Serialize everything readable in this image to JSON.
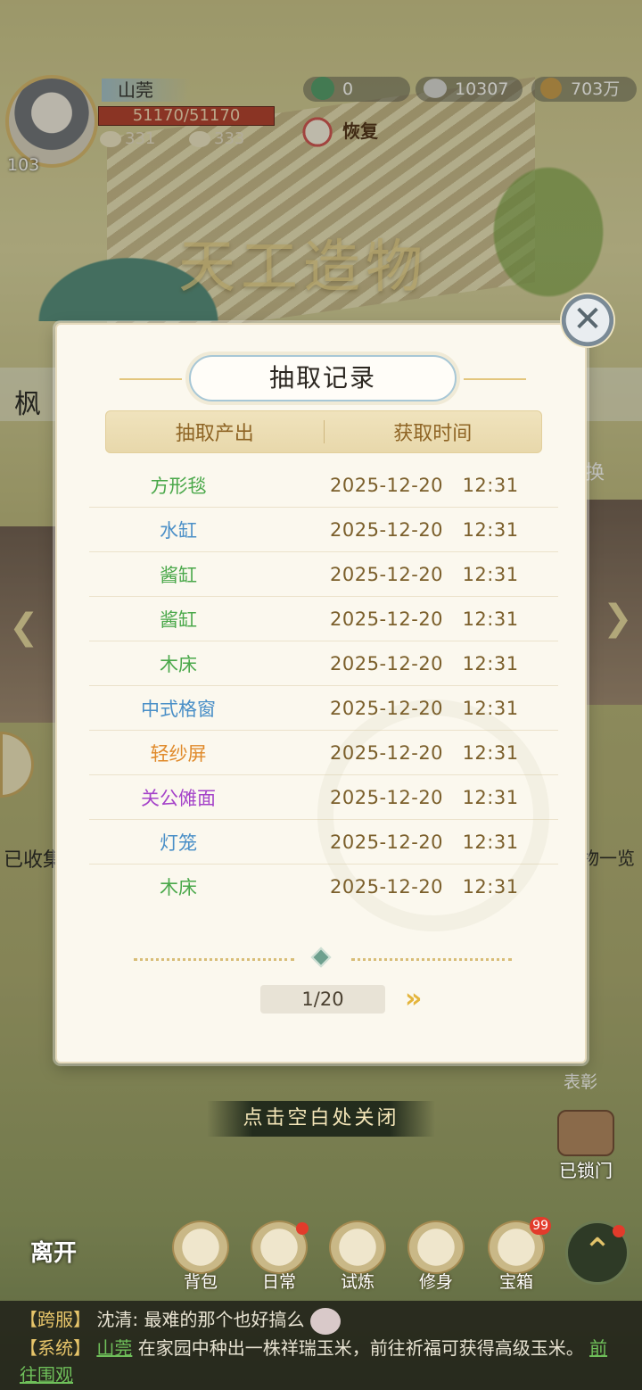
{
  "hud": {
    "player_name": "山莞",
    "hp": "51170/51170",
    "level": "103",
    "stat_a": "331",
    "stat_b": "333",
    "res_jade": "0",
    "res_silver": "10307",
    "res_coins": "703万",
    "restore_label": "恢复"
  },
  "background": {
    "banner_title": "天工造物",
    "left_tab_fragment": "枫",
    "left_collected_fragment": "已收集",
    "right_exchange_fragment": "换",
    "right_list_fragment": "物一览",
    "right_top_fragment": "表彰",
    "locked_door_label": "已锁门"
  },
  "modal": {
    "title": "抽取记录",
    "col_item": "抽取产出",
    "col_time": "获取时间",
    "rows": [
      {
        "item": "方形毯",
        "color": "#4aa84a",
        "time": "2025-12-20   12:31"
      },
      {
        "item": "水缸",
        "color": "#4a8fc7",
        "time": "2025-12-20   12:31"
      },
      {
        "item": "酱缸",
        "color": "#4aa84a",
        "time": "2025-12-20   12:31"
      },
      {
        "item": "酱缸",
        "color": "#4aa84a",
        "time": "2025-12-20   12:31"
      },
      {
        "item": "木床",
        "color": "#4aa84a",
        "time": "2025-12-20   12:31"
      },
      {
        "item": "中式格窗",
        "color": "#4a8fc7",
        "time": "2025-12-20   12:31"
      },
      {
        "item": "轻纱屏",
        "color": "#e08a2a",
        "time": "2025-12-20   12:31"
      },
      {
        "item": "关公傩面",
        "color": "#a543c9",
        "time": "2025-12-20   12:31"
      },
      {
        "item": "灯笼",
        "color": "#4a8fc7",
        "time": "2025-12-20   12:31"
      },
      {
        "item": "木床",
        "color": "#4aa84a",
        "time": "2025-12-20   12:31"
      }
    ],
    "page": "1/20",
    "close_hint": "点击空白处关闭"
  },
  "nav": {
    "leave": "离开",
    "items": [
      {
        "label": "背包"
      },
      {
        "label": "日常"
      },
      {
        "label": "试炼"
      },
      {
        "label": "修身"
      },
      {
        "label": "宝箱",
        "badge": "99"
      }
    ]
  },
  "chat": {
    "line1_tag": "【跨服】",
    "line1_name": "沈清:",
    "line1_text": "最难的那个也好搞么",
    "line2_tag": "【系统】",
    "line2_player": "山莞",
    "line2_text": "在家园中种出一株祥瑞玉米，前往祈福可获得高级玉米。",
    "line2_link": "前往围观"
  }
}
